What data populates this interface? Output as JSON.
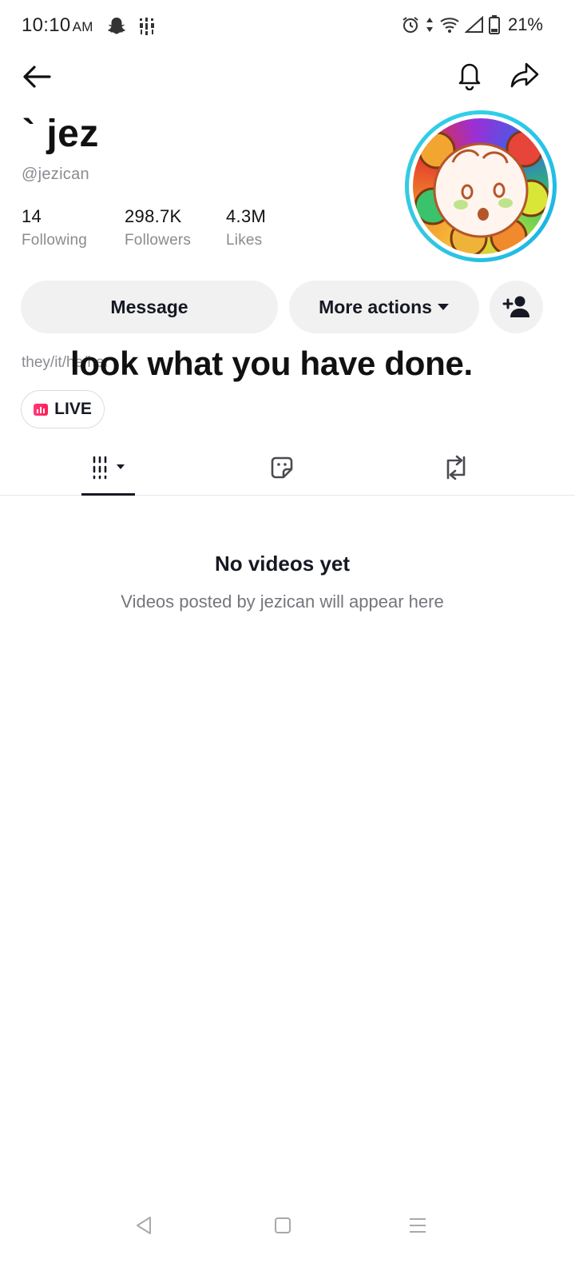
{
  "status_bar": {
    "time": "10:10",
    "ampm": "AM",
    "battery": "21%"
  },
  "profile": {
    "display_name": "` jez",
    "username": "@jezican",
    "stats": [
      {
        "value": "14",
        "label": "Following"
      },
      {
        "value": "298.7K",
        "label": "Followers"
      },
      {
        "value": "4.3M",
        "label": "Likes"
      }
    ],
    "pronouns": "they/it/he/her",
    "bio_overlay": "look what you have done."
  },
  "actions": {
    "message": "Message",
    "more_actions": "More actions",
    "add_friend_icon": "add-friend-icon"
  },
  "live_chip": {
    "label": "LIVE"
  },
  "tabs": [
    {
      "icon": "grid-icon",
      "active": true
    },
    {
      "icon": "sticker-icon",
      "active": false
    },
    {
      "icon": "repost-icon",
      "active": false
    }
  ],
  "empty_state": {
    "title": "No videos yet",
    "description": "Videos posted by jezican will appear here"
  },
  "colors": {
    "accent_ring": "#2fd0e8",
    "live_badge": "#ff2c68",
    "text_primary": "#161823",
    "text_secondary": "#8a8b91",
    "button_bg": "#f1f1f2"
  }
}
